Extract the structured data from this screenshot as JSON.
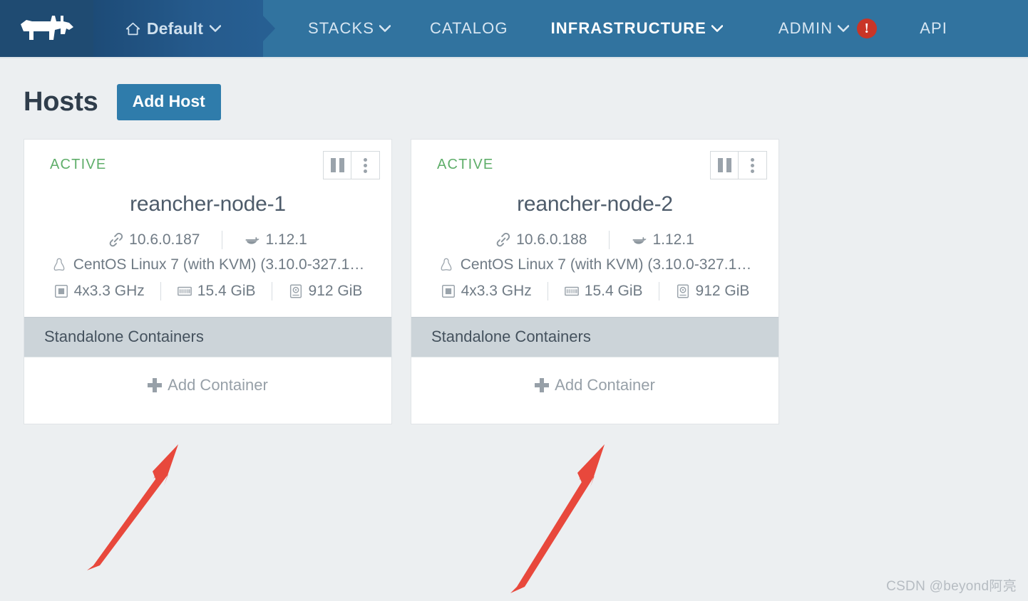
{
  "navbar": {
    "logo_icon": "rancher-cow-logo",
    "env_label": "Default",
    "env_icon": "home-icon",
    "items": [
      {
        "label": "STACKS",
        "has_chevron": true,
        "active": false
      },
      {
        "label": "CATALOG",
        "has_chevron": false,
        "active": false
      },
      {
        "label": "INFRASTRUCTURE",
        "has_chevron": true,
        "active": true
      },
      {
        "label": "ADMIN",
        "has_chevron": true,
        "active": false,
        "badge": "!"
      },
      {
        "label": "API",
        "has_chevron": false,
        "active": false
      }
    ],
    "colors": {
      "logo_zone": "#1f4b72",
      "env_zone": "#255a8c",
      "main_zone": "#31739f",
      "badge": "#c93527"
    }
  },
  "header": {
    "title": "Hosts",
    "add_host_label": "Add Host"
  },
  "hosts": [
    {
      "state": "ACTIVE",
      "state_color": "#5fae6a",
      "name": "reancher-node-1",
      "ip": "10.6.0.187",
      "docker_version": "1.12.1",
      "os": "CentOS Linux 7 (with KVM) (3.10.0-327.1…",
      "cpu": "4x3.3 GHz",
      "memory": "15.4 GiB",
      "disk": "912 GiB",
      "section_title": "Standalone Containers",
      "add_container_label": "Add Container",
      "pause_button": "pause-icon",
      "menu_button": "kebab-menu-icon"
    },
    {
      "state": "ACTIVE",
      "state_color": "#5fae6a",
      "name": "reancher-node-2",
      "ip": "10.6.0.188",
      "docker_version": "1.12.1",
      "os": "CentOS Linux 7 (with KVM) (3.10.0-327.1…",
      "cpu": "4x3.3 GHz",
      "memory": "15.4 GiB",
      "disk": "912 GiB",
      "section_title": "Standalone Containers",
      "add_container_label": "Add Container",
      "pause_button": "pause-icon",
      "menu_button": "kebab-menu-icon"
    }
  ],
  "annotations": {
    "arrow_color": "#e8483c",
    "count": 2,
    "points_to": "Add Container"
  },
  "watermark": "CSDN @beyond阿亮"
}
